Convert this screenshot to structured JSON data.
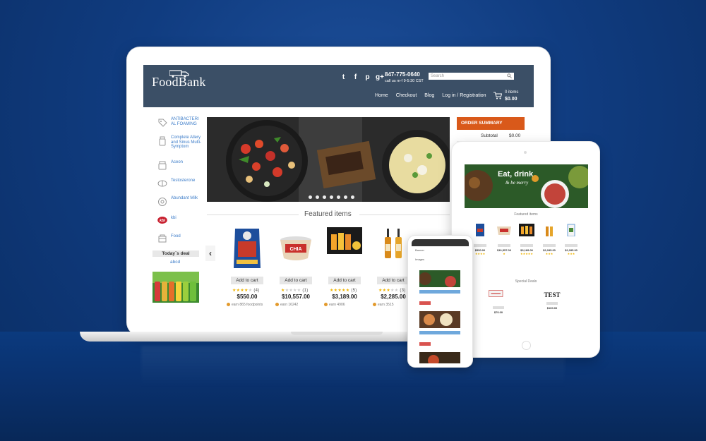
{
  "laptop": {
    "header": {
      "logo": "FoodBank",
      "phone": "847-775-0640",
      "hours": "call us m-f 9-5:30 CST",
      "search_placeholder": "Search",
      "nav": [
        "Home",
        "Checkout",
        "Blog",
        "Log in / Registration"
      ],
      "cart_items": "0 items",
      "cart_total": "$0.00",
      "social_icons": [
        "twitter-icon",
        "facebook-icon",
        "pinterest-icon",
        "google-plus-icon"
      ]
    },
    "sidebar": {
      "items": [
        {
          "label": "ANTIBACTERI AL FOAMING",
          "icon": "tag-icon"
        },
        {
          "label": "Complete Allery and Sinus Multi-Symptom",
          "icon": "bottle-icon"
        },
        {
          "label": "Aceon",
          "icon": "jar-icon"
        },
        {
          "label": "Testosterone",
          "icon": "pill-icon"
        },
        {
          "label": "Abundant Milk",
          "icon": "flower-icon"
        },
        {
          "label": "kbi",
          "icon": "kbi-logo-icon"
        },
        {
          "label": "Food",
          "icon": "food-icon"
        }
      ],
      "deal_title": "Today`s deal",
      "deal_link": "abcd"
    },
    "featured_title": "Featured items",
    "products": [
      {
        "price": "$550.00",
        "rating": 4,
        "count": "(4)",
        "earn": "earn 865 foodpoints",
        "add": "Add to cart"
      },
      {
        "price": "$10,557.00",
        "rating": 1,
        "count": "(1)",
        "earn": "earn 16242",
        "add": "Add to cart"
      },
      {
        "price": "$3,189.00",
        "rating": 5,
        "count": "(5)",
        "earn": "earn 4906",
        "add": "Add to cart"
      },
      {
        "price": "$2,285.00",
        "rating": 3,
        "count": "(3)",
        "earn": "earn 3515",
        "add": "Add to cart"
      }
    ],
    "order_summary": {
      "title": "ORDER SUMMARY",
      "subtotal_label": "Subtotal",
      "subtotal_value": "$0.00"
    }
  },
  "tablet": {
    "banner_title": "Eat, drink",
    "banner_subtitle": "& be merry",
    "featured_title": "Featured items",
    "special_title": "Special Deals",
    "deal_logo_text": "TEST",
    "product_prices": [
      "$550.00",
      "$10,557.00",
      "$3,189.00",
      "$2,285.00",
      "$2,285.00"
    ],
    "deal_prices": [
      "$70.00",
      "$100.00"
    ]
  },
  "phone": {
    "header_label": "Banner",
    "section_label": "Images"
  },
  "colors": {
    "background": "#103c80",
    "header": "#3b4f66",
    "accent": "#d9591a",
    "link": "#3a7bc8",
    "star": "#f0b400"
  }
}
